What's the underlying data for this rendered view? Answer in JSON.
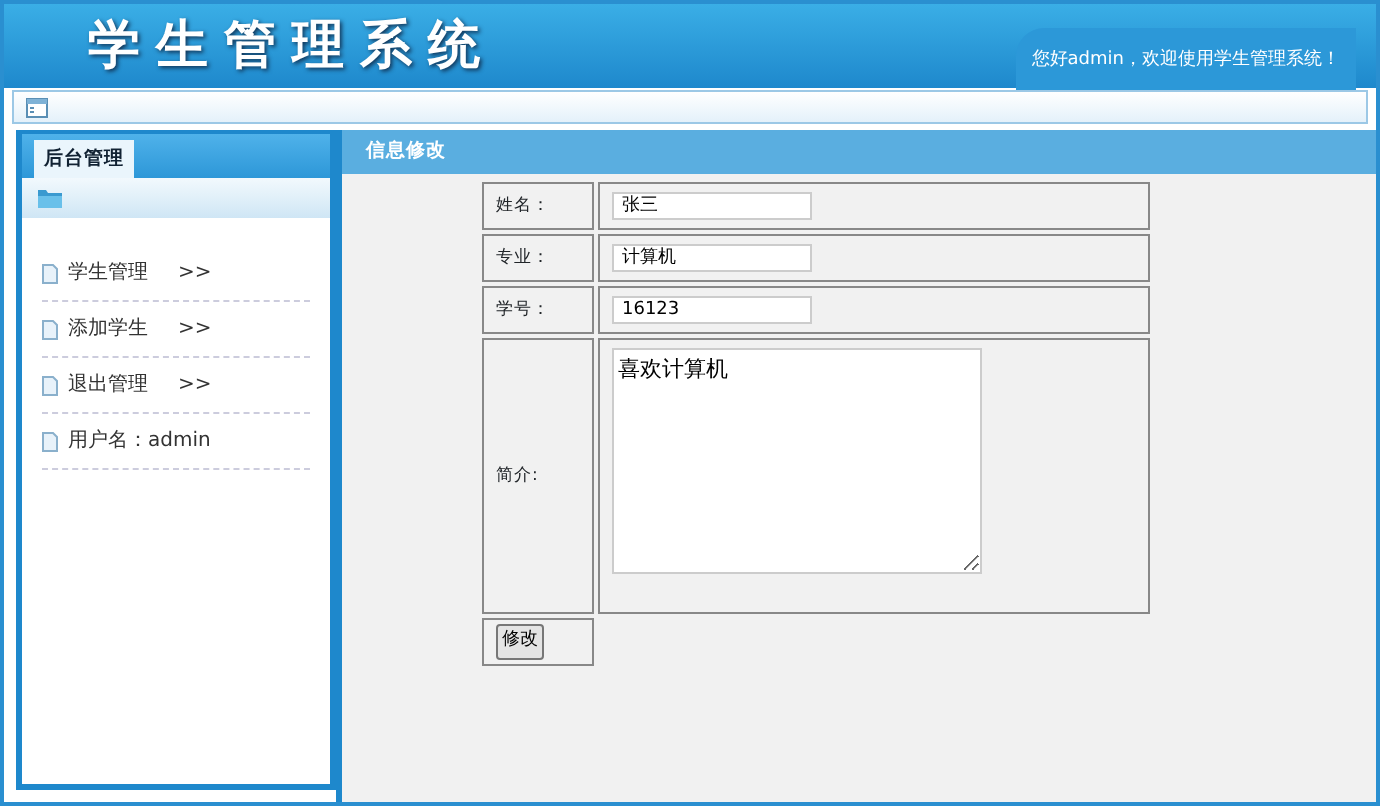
{
  "header": {
    "title": "学生管理系统",
    "greeting": "您好admin，欢迎使用学生管理系统！"
  },
  "sidebar": {
    "tab": "后台管理",
    "items": [
      {
        "label": "学生管理",
        "arrow": ">>"
      },
      {
        "label": "添加学生",
        "arrow": ">>"
      },
      {
        "label": "退出管理",
        "arrow": ">>"
      },
      {
        "label": "用户名：admin"
      }
    ]
  },
  "panel": {
    "title": "信息修改"
  },
  "form": {
    "fields": [
      {
        "kind": "input",
        "label": "姓名：",
        "value": "张三"
      },
      {
        "kind": "input",
        "label": "专业：",
        "value": "计算机"
      },
      {
        "kind": "input",
        "label": "学号：",
        "value": "16123"
      },
      {
        "kind": "textarea",
        "label": "简介:",
        "value": "喜欢计算机"
      }
    ],
    "submit": "修改"
  }
}
